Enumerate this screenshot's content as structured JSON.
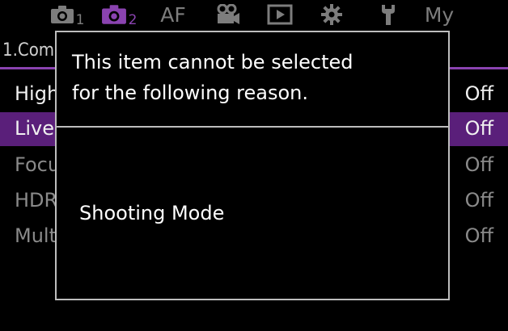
{
  "tabs": {
    "shoot1": {
      "icon": "camera-icon",
      "sub": "1"
    },
    "shoot2": {
      "icon": "camera-icon",
      "sub": "2"
    },
    "af": {
      "label": "AF"
    },
    "video": {
      "icon": "movie-camera-icon"
    },
    "playback": {
      "icon": "play-icon"
    },
    "custom": {
      "icon": "gear-icon"
    },
    "setup": {
      "icon": "wrench-icon"
    },
    "my": {
      "label": "My"
    }
  },
  "colors": {
    "accent": "#8a43b0",
    "selected_row": "#5a1f7a",
    "inactive_tab": "#7d7d7d",
    "dialog_border": "#bdbdbd"
  },
  "menu": {
    "title": "1.Com",
    "rows": [
      {
        "label": "High",
        "value": "Off"
      },
      {
        "label": "Live",
        "value": "Off"
      },
      {
        "label": "Focu",
        "value": "Off"
      },
      {
        "label": "HDR",
        "value": "Off"
      },
      {
        "label": "Mult",
        "value": "Off"
      }
    ]
  },
  "dialog": {
    "message": "This item cannot be selected\nfor the following reason.",
    "reason": "Shooting Mode"
  }
}
